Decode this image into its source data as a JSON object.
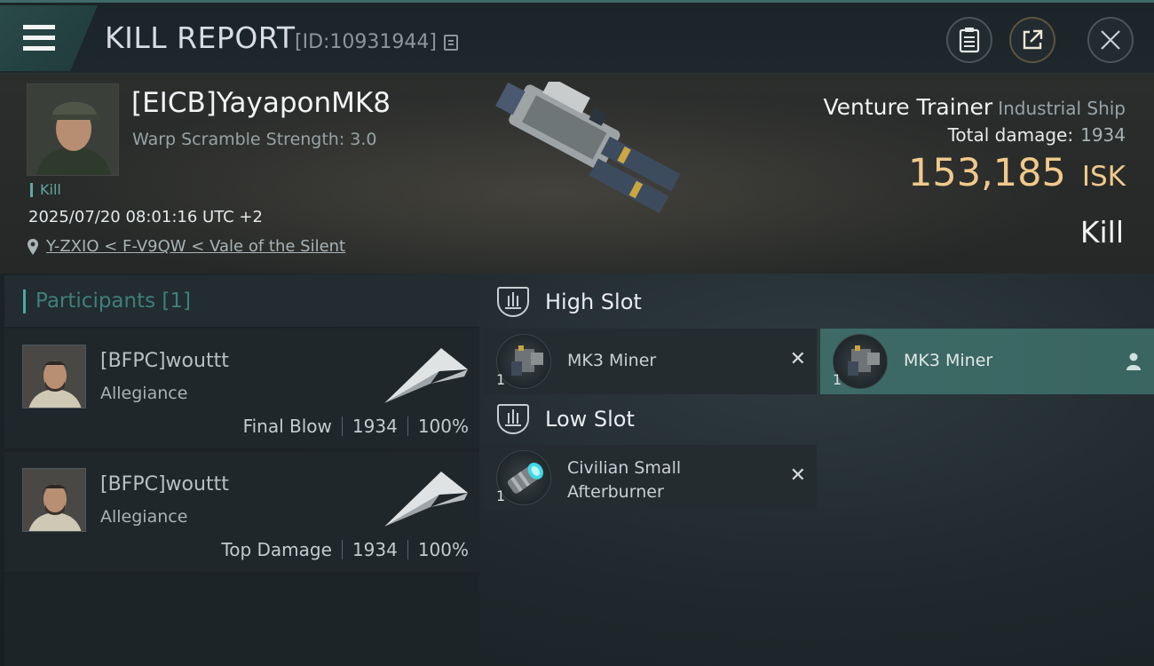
{
  "header": {
    "title": "KILL REPORT",
    "report_id": "[ID:10931944]",
    "icons": [
      "menu-icon",
      "copy-icon",
      "clipboard-icon",
      "share-icon",
      "close-icon"
    ]
  },
  "victim": {
    "name": "[EICB]YayaponMK8",
    "warp_scramble": "Warp Scramble Strength: 3.0",
    "kill_tag": "Kill",
    "timestamp": "2025/07/20 08:01:16 UTC +2",
    "location": "Y-ZXIO < F-V9QW < Vale of the Silent",
    "ship_name": "Venture Trainer",
    "ship_class": "Industrial Ship",
    "total_damage_label": "Total damage:",
    "total_damage_value": "1934",
    "isk_value": "153,185",
    "isk_unit": "ISK",
    "result": "Kill"
  },
  "participants": {
    "header": "Participants [1]",
    "items": [
      {
        "name": "[BFPC]wouttt",
        "alliance": "Allegiance",
        "role": "Final Blow",
        "damage": "1934",
        "percent": "100%"
      },
      {
        "name": "[BFPC]wouttt",
        "alliance": "Allegiance",
        "role": "Top Damage",
        "damage": "1934",
        "percent": "100%"
      }
    ]
  },
  "fitting": {
    "high_slot_label": "High Slot",
    "low_slot_label": "Low Slot",
    "high_modules": [
      {
        "name": "MK3 Miner",
        "qty": "1",
        "state": "destroyed"
      },
      {
        "name": "MK3 Miner",
        "qty": "1",
        "state": "dropped"
      }
    ],
    "low_modules": [
      {
        "name_line1": "Civilian Small",
        "name_line2": "Afterburner",
        "qty": "1",
        "state": "destroyed"
      }
    ],
    "destroyed_mark": "✕"
  },
  "colors": {
    "accent_teal": "#4aa9a3",
    "isk_gold": "#f0c98a",
    "dropped_highlight": "#3d6a67"
  }
}
